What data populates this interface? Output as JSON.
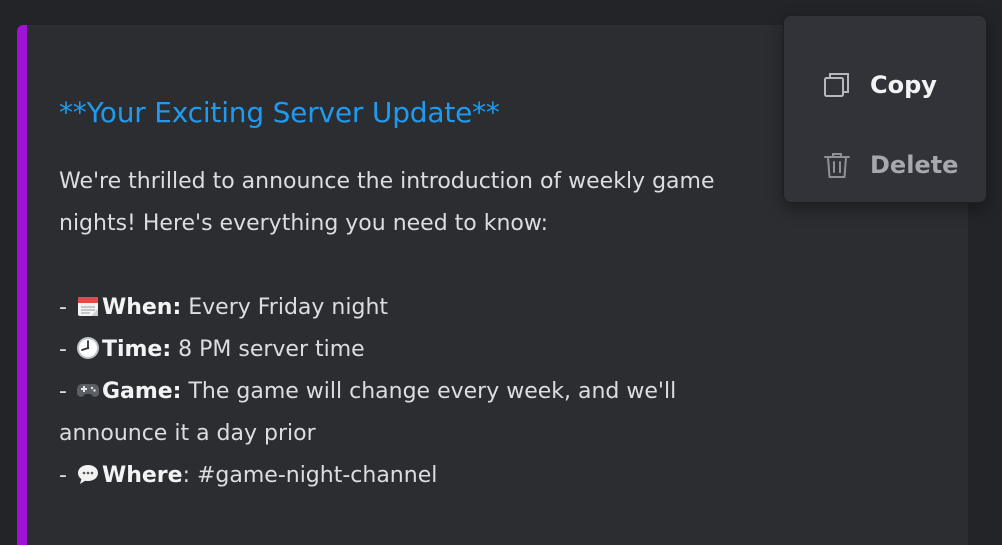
{
  "embed": {
    "accent_color": "#a012d6",
    "title": "**Your Exciting Server Update**",
    "intro": "We're thrilled to announce the introduction of weekly game nights! Here's everything you need to know:",
    "items": [
      {
        "prefix": " - ",
        "icon": "calendar-icon",
        "label": "When:",
        "value": " Every Friday night"
      },
      {
        "prefix": " - ",
        "icon": "clock-icon",
        "label": "Time:",
        "value": " 8 PM server time"
      },
      {
        "prefix": " - ",
        "icon": "gamepad-icon",
        "label": "Game:",
        "value": " The game will change every week, and we'll",
        "continuation": "announce it a day prior"
      },
      {
        "prefix": " - ",
        "icon": "speech-bubble-icon",
        "label": "Where",
        "value": ": #game-night-channel"
      }
    ]
  },
  "context_menu": {
    "copy_label": "Copy",
    "copy_icon": "copy-icon",
    "delete_label": "Delete",
    "delete_icon": "trash-icon"
  }
}
